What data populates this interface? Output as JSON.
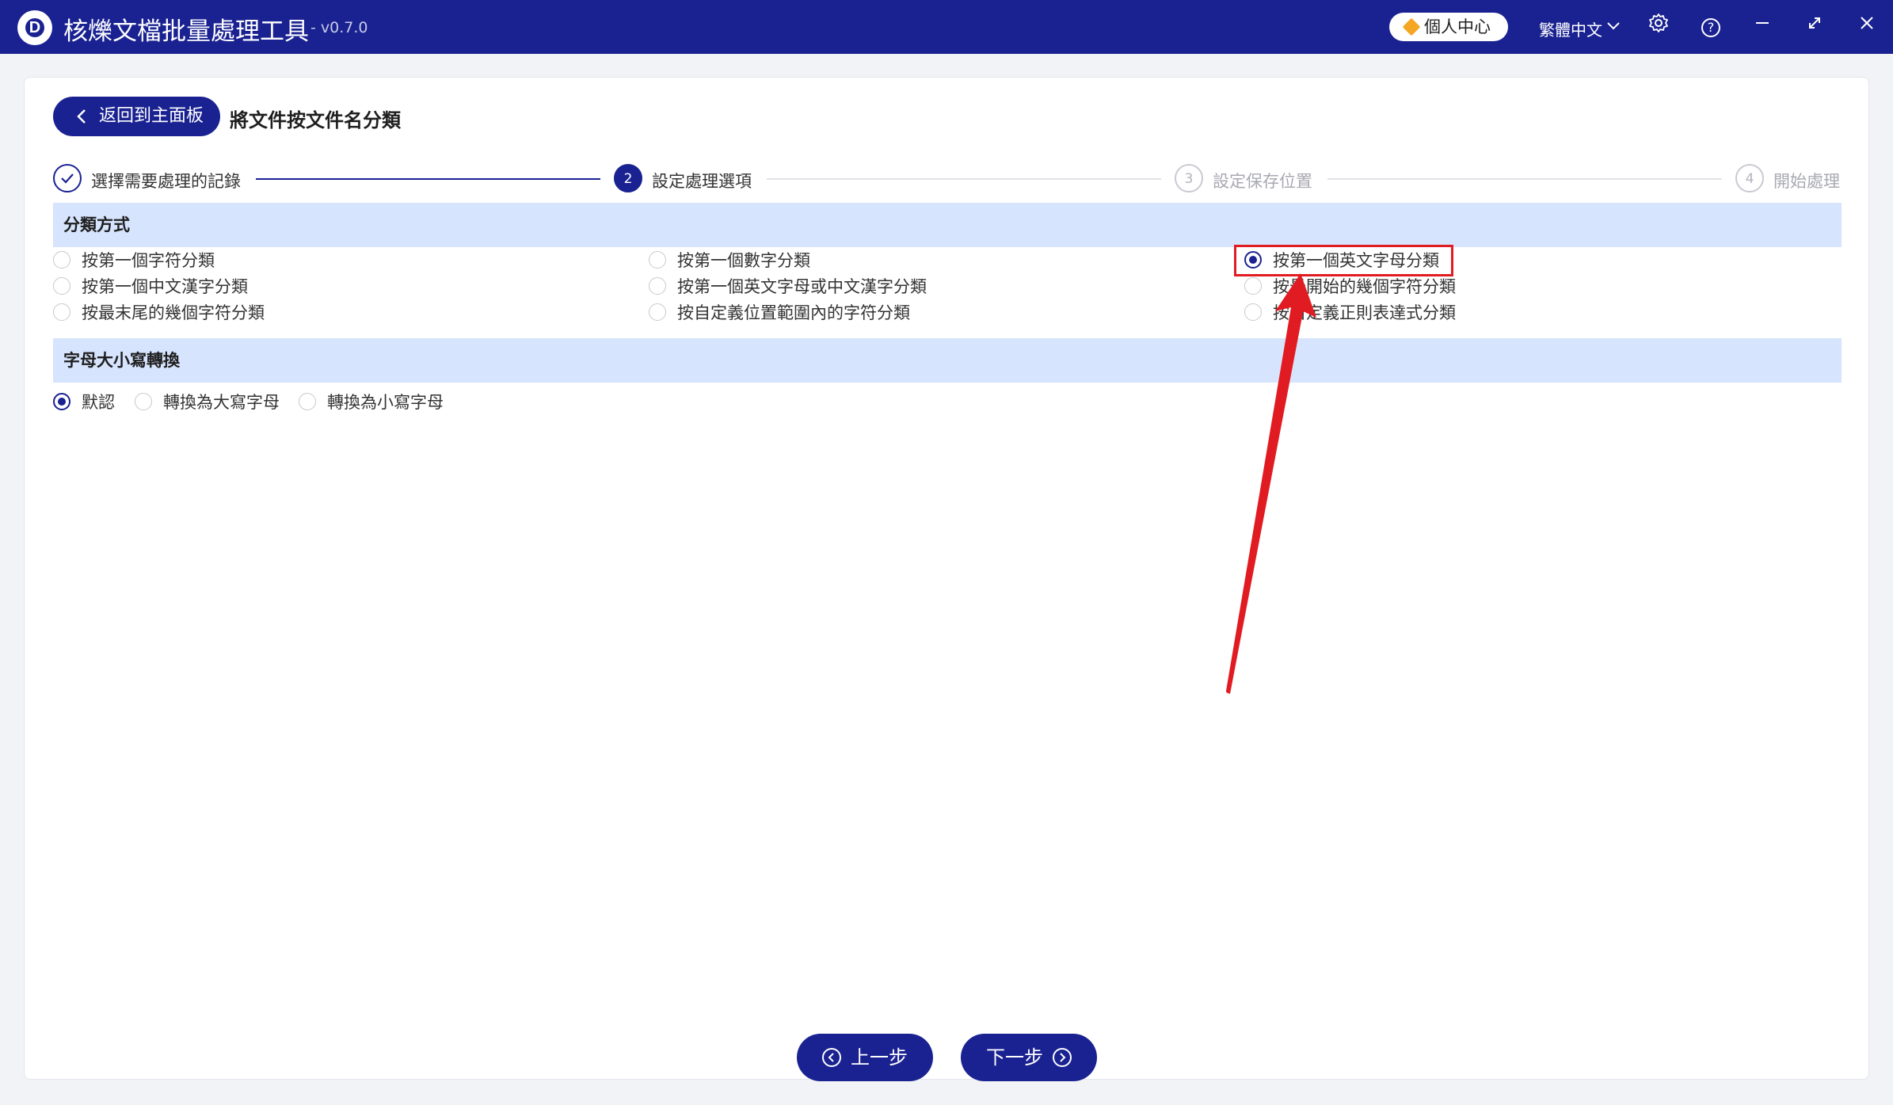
{
  "app": {
    "logo_letter": "D",
    "title": "核爍文檔批量處理工具",
    "version": "- v0.7.0",
    "user_center": "個人中心",
    "language": "繁體中文"
  },
  "header": {
    "back_label": "返回到主面板",
    "page_title": "將文件按文件名分類"
  },
  "steps": [
    {
      "label": "選擇需要處理的記錄",
      "state": "done"
    },
    {
      "number": "2",
      "label": "設定處理選項",
      "state": "active"
    },
    {
      "number": "3",
      "label": "設定保存位置",
      "state": "idle"
    },
    {
      "number": "4",
      "label": "開始處理",
      "state": "idle"
    }
  ],
  "classification": {
    "heading": "分類方式",
    "options": [
      {
        "label": "按第一個字符分類",
        "checked": false
      },
      {
        "label": "按第一個數字分類",
        "checked": false
      },
      {
        "label": "按第一個英文字母分類",
        "checked": true
      },
      {
        "label": "按第一個中文漢字分類",
        "checked": false
      },
      {
        "label": "按第一個英文字母或中文漢字分類",
        "checked": false
      },
      {
        "label": "按最開始的幾個字符分類",
        "checked": false
      },
      {
        "label": "按最末尾的幾個字符分類",
        "checked": false
      },
      {
        "label": "按自定義位置範圍內的字符分類",
        "checked": false
      },
      {
        "label": "按自定義正則表達式分類",
        "checked": false
      }
    ]
  },
  "case_conversion": {
    "heading": "字母大小寫轉換",
    "options": [
      {
        "label": "默認",
        "checked": true
      },
      {
        "label": "轉換為大寫字母",
        "checked": false
      },
      {
        "label": "轉換為小寫字母",
        "checked": false
      }
    ]
  },
  "footer": {
    "prev_label": "上一步",
    "next_label": "下一步"
  },
  "colors": {
    "brand": "#1a2291",
    "section_bg": "#d7e4fd",
    "annotation": "#e11b22"
  }
}
